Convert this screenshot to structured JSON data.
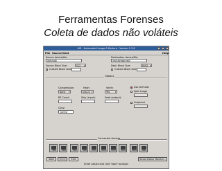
{
  "slide": {
    "title": "Ferramentas Forenses",
    "subtitle": "Coleta de dados não voláteis"
  },
  "window": {
    "title": "AIR - Automated Image & Restore - Version 1.2.6",
    "menu": {
      "file": "File",
      "source": "Source",
      "dest": "Dest",
      "help": "Help"
    }
  },
  "source": {
    "device_label": "Source device/file:",
    "device_value": "/dev/sdb",
    "block_label": "Source Block Size:",
    "block_value": "512",
    "custom_label": "Custom Block Size:"
  },
  "dest": {
    "device_label": "Destination device/file:",
    "device_value": "/mnt/preserved/",
    "block_label": "Dest. Block Size:",
    "block_value": "8192",
    "custom_label": "Custom Block Size:"
  },
  "options": {
    "heading": "Options",
    "compression_label": "Compression:",
    "compression_value": "None",
    "hash_label": "Hash:",
    "hash_value": "sha1/2",
    "verify_label": "Verify:",
    "verify_value": "Yes",
    "dcfldd_label": "Use DCFLDD",
    "split_label": "Split image",
    "bs_count_label": "BS Count:",
    "skip_label": "Skip (input):",
    "seek_label": "Seek (output):",
    "conv_label": "Conv:",
    "conv_value": "noerror",
    "graphical_label": "Graphical"
  },
  "devices": {
    "heading": "Connected devices",
    "items": [
      "SDA",
      "SDB",
      "HDA",
      "HDB",
      "HDC1",
      "HDC2",
      "HDC3",
      "HDC4",
      "ZERO",
      "NULL"
    ]
  },
  "buttons": {
    "start": "Start",
    "stop": "Stop",
    "exit": "Exit",
    "status": "Show Status Monitor..."
  },
  "status_text": "Enter values and click 'Start' to begin"
}
